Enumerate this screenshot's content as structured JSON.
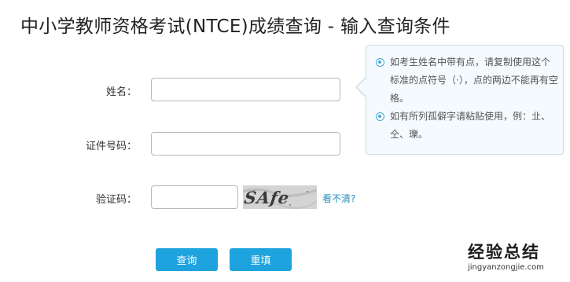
{
  "page": {
    "title": "中小学教师资格考试(NTCE)成绩查询 - 输入查询条件"
  },
  "form": {
    "name_label": "姓名：",
    "name_value": "",
    "id_label": "证件号码：",
    "id_value": "",
    "captcha_label": "验证码：",
    "captcha_value": "",
    "captcha_image_text": "SAfe",
    "refresh_link": "看不清?"
  },
  "tips": [
    {
      "text": "如考生姓名中带有点，请复制使用这个标准的点符号（·），点的两边不能再有空格。"
    },
    {
      "text": "如有所列孤僻字请粘贴使用，例：㐀、仝、瓅。"
    }
  ],
  "buttons": {
    "query": "查询",
    "reset": "重填"
  },
  "watermark": {
    "title": "经验总结",
    "url": "jingyanzongjie.com"
  },
  "colors": {
    "accent": "#1fa3de",
    "link": "#2a8fbd",
    "tip_bg": "#f4fafd"
  }
}
